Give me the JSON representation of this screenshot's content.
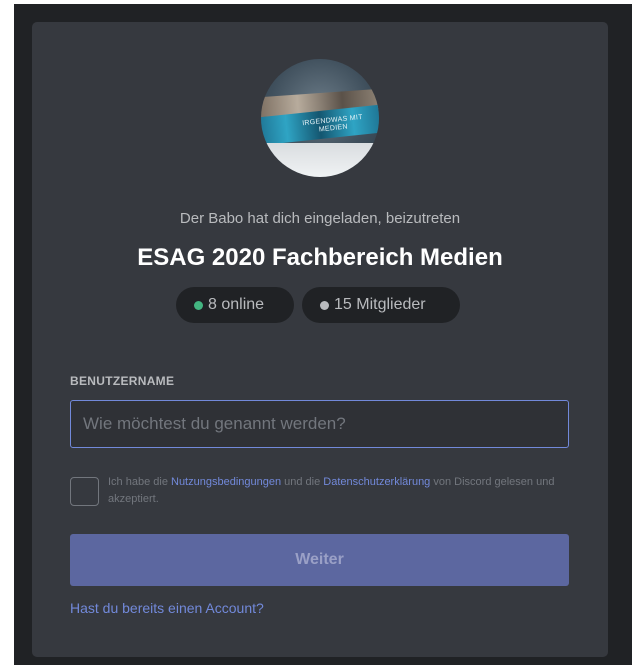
{
  "invite": {
    "inviter_text": "Der Babo hat dich eingeladen, beizutreten",
    "server_name": "ESAG 2020 Fachbereich Medien",
    "avatar_text": "IRGENDWAS MIT MEDIEN",
    "online_count": "8 online",
    "member_count": "15 Mitglieder"
  },
  "form": {
    "username_label": "BENUTZERNAME",
    "username_placeholder": "Wie möchtest du genannt werden?",
    "username_value": "",
    "terms_prefix": "Ich habe die ",
    "terms_link": "Nutzungsbedingungen",
    "terms_middle": " und die ",
    "privacy_link": "Datenschutzerklärung",
    "terms_suffix": " von Discord gelesen und akzeptiert.",
    "continue_label": "Weiter",
    "login_link": "Hast du bereits einen Account?"
  },
  "colors": {
    "modal_bg": "#36393f",
    "backdrop": "#202225",
    "accent": "#7289da",
    "online": "#43b581"
  }
}
